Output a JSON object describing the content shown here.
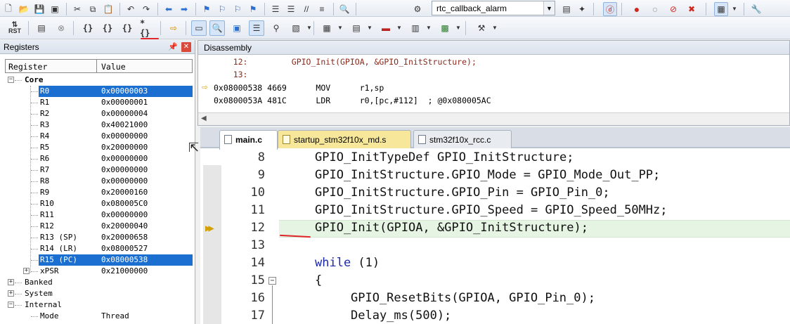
{
  "toolbar": {
    "target_combo": "rtc_callback_alarm",
    "rst_label": "RST"
  },
  "registers": {
    "title": "Registers",
    "col_register": "Register",
    "col_value": "Value",
    "groups": {
      "core": "Core",
      "banked": "Banked",
      "system": "System",
      "internal": "Internal"
    },
    "core_rows": [
      {
        "name": "R0",
        "value": "0x00000003"
      },
      {
        "name": "R1",
        "value": "0x00000001"
      },
      {
        "name": "R2",
        "value": "0x00000004"
      },
      {
        "name": "R3",
        "value": "0x40021000"
      },
      {
        "name": "R4",
        "value": "0x00000000"
      },
      {
        "name": "R5",
        "value": "0x20000000"
      },
      {
        "name": "R6",
        "value": "0x00000000"
      },
      {
        "name": "R7",
        "value": "0x00000000"
      },
      {
        "name": "R8",
        "value": "0x00000000"
      },
      {
        "name": "R9",
        "value": "0x20000160"
      },
      {
        "name": "R10",
        "value": "0x080005C0"
      },
      {
        "name": "R11",
        "value": "0x00000000"
      },
      {
        "name": "R12",
        "value": "0x20000040"
      },
      {
        "name": "R13 (SP)",
        "value": "0x20000658"
      },
      {
        "name": "R14 (LR)",
        "value": "0x08000527"
      },
      {
        "name": "R15 (PC)",
        "value": "0x08000538"
      },
      {
        "name": "xPSR",
        "value": "0x21000000"
      }
    ],
    "internal_rows": [
      {
        "name": "Mode",
        "value": "Thread"
      }
    ]
  },
  "disassembly": {
    "title": "Disassembly",
    "lines": [
      {
        "kind": "src",
        "text": "    12:         GPIO_Init(GPIOA, &GPIO_InitStructure);"
      },
      {
        "kind": "src",
        "text": "    13:"
      },
      {
        "kind": "asm",
        "text": "0x08000538 4669      MOV      r1,sp"
      },
      {
        "kind": "asm",
        "text": "0x0800053A 481C      LDR      r0,[pc,#112]  ; @0x080005AC"
      }
    ]
  },
  "editor": {
    "tabs": [
      {
        "label": "main.c"
      },
      {
        "label": "startup_stm32f10x_md.s"
      },
      {
        "label": "stm32f10x_rcc.c"
      }
    ],
    "lines": [
      {
        "num": "8",
        "kw": "",
        "text": "GPIO_InitTypeDef GPIO_InitStructure;",
        "indent": 0
      },
      {
        "num": "9",
        "kw": "",
        "text": "GPIO_InitStructure.GPIO_Mode = GPIO_Mode_Out_PP;",
        "indent": 0
      },
      {
        "num": "10",
        "kw": "",
        "text": "GPIO_InitStructure.GPIO_Pin = GPIO_Pin_0;",
        "indent": 0
      },
      {
        "num": "11",
        "kw": "",
        "text": "GPIO_InitStructure.GPIO_Speed = GPIO_Speed_50MHz;",
        "indent": 0
      },
      {
        "num": "12",
        "kw": "",
        "text": "GPIO_Init(GPIOA, &GPIO_InitStructure);",
        "indent": 0
      },
      {
        "num": "13",
        "kw": "",
        "text": "",
        "indent": 0
      },
      {
        "num": "14",
        "kw": "while",
        "text": " (1)",
        "indent": 0
      },
      {
        "num": "15",
        "kw": "",
        "text": "{",
        "indent": 0
      },
      {
        "num": "16",
        "kw": "",
        "text": "GPIO_ResetBits(GPIOA, GPIO_Pin_0);",
        "indent": 1
      },
      {
        "num": "17",
        "kw": "",
        "text": "Delay_ms(500);",
        "indent": 1
      }
    ]
  },
  "colors": {
    "selection": "#1a6fd1",
    "current_line": "#e6f5e3",
    "keyword": "#1d2aa8",
    "annotation_red": "#e0252b",
    "disasm_source": "#8a2b1c"
  }
}
